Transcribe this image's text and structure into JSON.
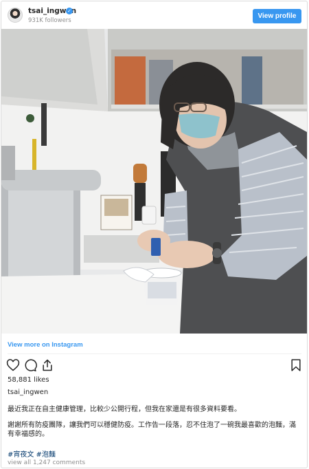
{
  "header": {
    "username": "tsai_ingwen",
    "followers": "931K followers",
    "view_profile_label": "View profile",
    "verified_mark": "✓"
  },
  "post": {
    "photo_alt": "Woman in a face mask opening a cup of instant noodles in a kitchen",
    "view_more_label": "View more on Instagram",
    "likes": "58,881 likes",
    "caption_user": "tsai_ingwen",
    "caption_line1": "最近我正在自主健康管理，比較少公開行程，但我在家還是有很多資料要看。",
    "caption_line2": "謝謝所有防疫團隊，讓我們可以穩健防疫。工作告一段落，忍不住泡了一碗我最喜歡的泡麵，滿有幸福感的。",
    "hashtags": "#宵夜文 #泡麵",
    "comments_label": "view all 1,247 comments"
  },
  "icons": [
    "heart-icon",
    "comment-icon",
    "share-icon",
    "bookmark-icon"
  ],
  "colors": {
    "accent": "#3897f0",
    "hashtag": "#00376b",
    "muted": "#8e8e8e"
  }
}
